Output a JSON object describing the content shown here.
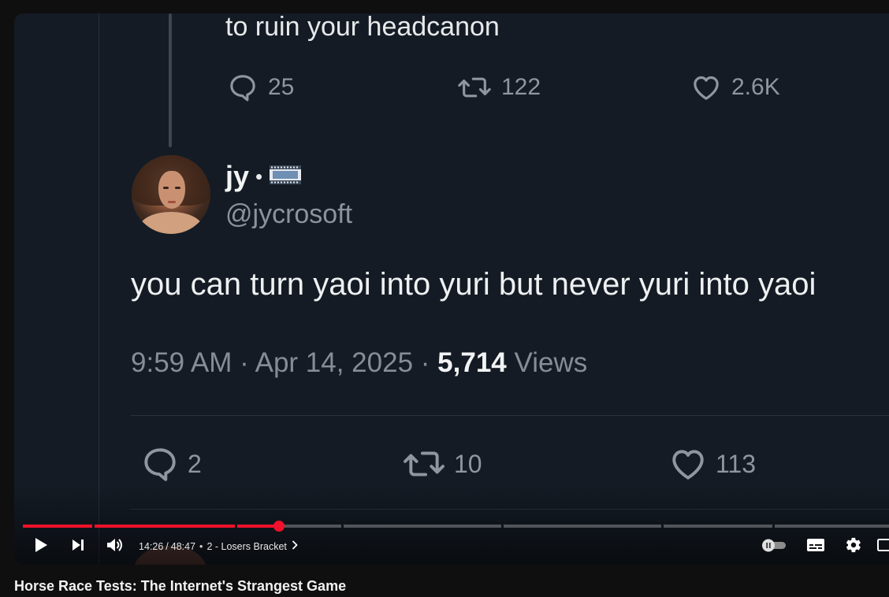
{
  "video": {
    "previous_tweet": {
      "text": "to ruin your headcanon",
      "replies": "25",
      "retweets": "122",
      "likes": "2.6K"
    },
    "tweet": {
      "author_name": "jy",
      "separator": "•",
      "handle": "@jycrosoft",
      "text": "you can turn yaoi into yuri but never yuri into yaoi",
      "time": "9:59 AM",
      "date": "Apr 14, 2025",
      "views_count": "5,714",
      "views_label": "Views",
      "replies": "2",
      "retweets": "10",
      "likes": "113"
    }
  },
  "player": {
    "current_time": "14:26",
    "duration": "48:47",
    "time_separator": "/",
    "chapter": "2 - Losers Bracket",
    "progress_fraction": 0.296,
    "accent_color": "#f0112a",
    "icons": [
      "play-icon",
      "next-icon",
      "volume-icon",
      "chevron-right-icon",
      "autoplay-toggle-icon",
      "subtitles-icon",
      "settings-icon",
      "miniplayer-icon"
    ]
  },
  "page": {
    "video_title": "Horse Race Tests: The Internet's Strangest Game"
  }
}
